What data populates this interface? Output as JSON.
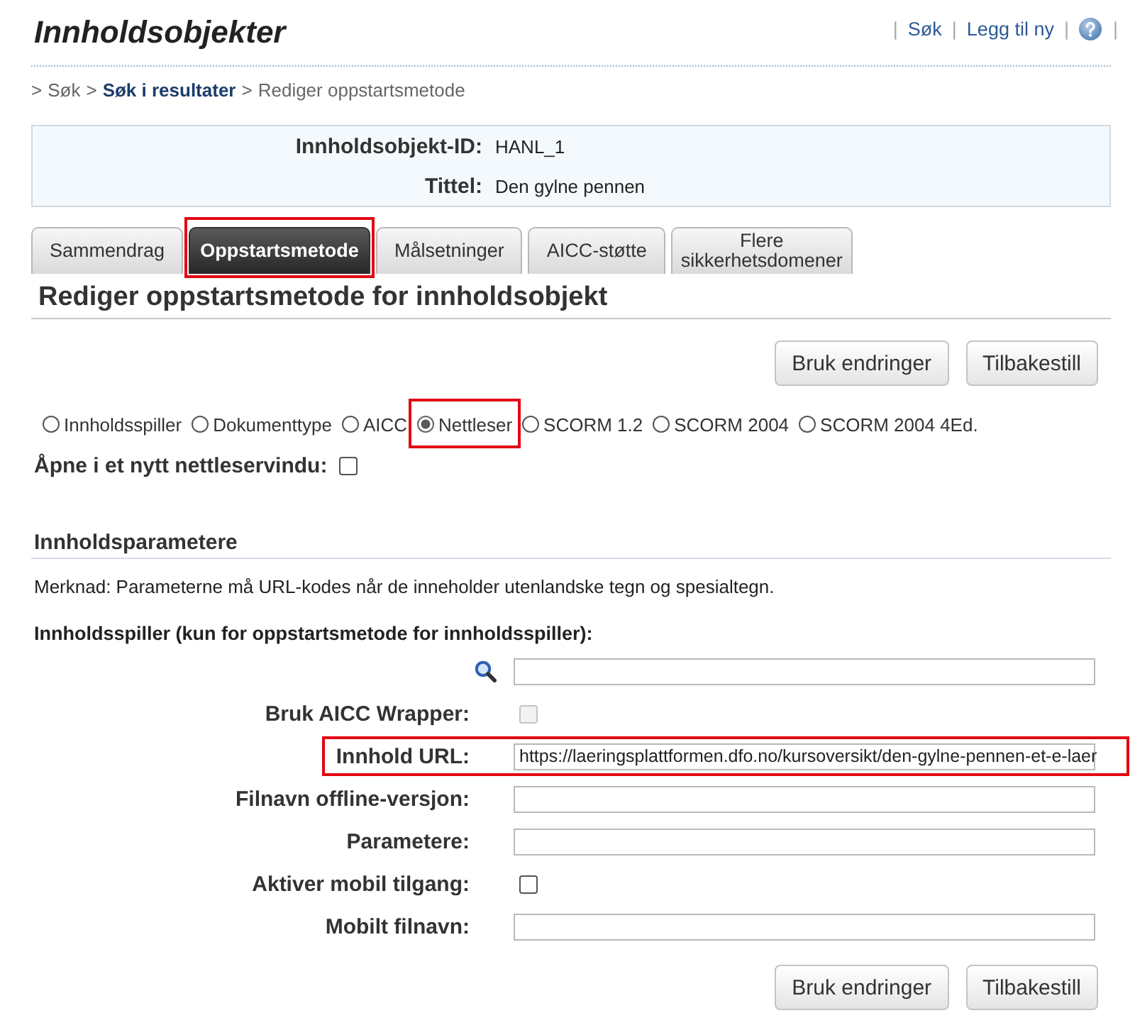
{
  "header": {
    "title": "Innholdsobjekter",
    "separator": "|",
    "links": [
      "Søk",
      "Legg til ny"
    ]
  },
  "breadcrumb": {
    "separator": ">",
    "items": [
      {
        "label": "Søk",
        "emphasized": false
      },
      {
        "label": "Søk i resultater",
        "emphasized": true
      },
      {
        "label": "Rediger oppstartsmetode",
        "emphasized": false
      }
    ]
  },
  "info": [
    {
      "label": "Innholdsobjekt-ID:",
      "value": "HANL_1"
    },
    {
      "label": "Tittel:",
      "value": "Den gylne pennen"
    }
  ],
  "tabs": [
    {
      "label": "Sammendrag",
      "selected": false,
      "highlighted": false
    },
    {
      "label": "Oppstartsmetode",
      "selected": true,
      "highlighted": true
    },
    {
      "label": "Målsetninger",
      "selected": false,
      "highlighted": false
    },
    {
      "label": "AICC-støtte",
      "selected": false,
      "highlighted": false
    },
    {
      "label": "Flere sikkerhetsdomener",
      "selected": false,
      "highlighted": false
    }
  ],
  "heading": "Rediger oppstartsmetode for innholdsobjekt",
  "buttons_top": [
    "Bruk endringer",
    "Tilbakestill"
  ],
  "launch_methods": [
    {
      "label": "Innholdsspiller",
      "selected": false,
      "highlighted": false
    },
    {
      "label": "Dokumenttype",
      "selected": false,
      "highlighted": false
    },
    {
      "label": "AICC",
      "selected": false,
      "highlighted": false
    },
    {
      "label": "Nettleser",
      "selected": true,
      "highlighted": true
    },
    {
      "label": "SCORM 1.2",
      "selected": false,
      "highlighted": false
    },
    {
      "label": "SCORM 2004",
      "selected": false,
      "highlighted": false
    },
    {
      "label": "SCORM 2004 4Ed.",
      "selected": false,
      "highlighted": false
    }
  ],
  "new_window": {
    "label": "Åpne i et nytt nettleservindu:",
    "checked": false
  },
  "section": {
    "title": "Innholdsparametere",
    "note": "Merknad: Parameterne må URL-kodes når de inneholder utenlandske tegn og spesialtegn.",
    "subheading": "Innholdsspiller (kun for oppstartsmetode for innholdsspiller):"
  },
  "fields": [
    {
      "kind": "search",
      "highlighted": false
    },
    {
      "kind": "checkbox",
      "label": "Bruk AICC Wrapper:",
      "checked": false,
      "disabled": true,
      "highlighted": false
    },
    {
      "kind": "text",
      "label": "Innhold URL:",
      "value": "https://laeringsplattformen.dfo.no/kursoversikt/den-gylne-pennen-et-e-laer",
      "highlighted": true
    },
    {
      "kind": "text",
      "label": "Filnavn offline-versjon:",
      "highlighted": false
    },
    {
      "kind": "text",
      "label": "Parametere:",
      "highlighted": false
    },
    {
      "kind": "checkbox",
      "label": "Aktiver mobil tilgang:",
      "checked": false,
      "disabled": false,
      "highlighted": false
    },
    {
      "kind": "text",
      "label": "Mobilt filnavn:",
      "highlighted": false
    }
  ],
  "buttons_bottom": [
    "Bruk endringer",
    "Tilbakestill"
  ]
}
